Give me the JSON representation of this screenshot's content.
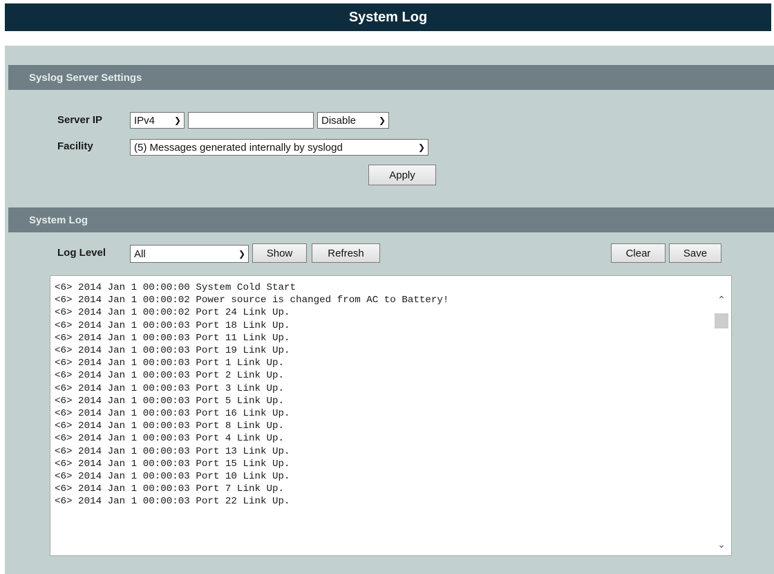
{
  "page_title": "System Log",
  "syslog_settings": {
    "header": "Syslog Server Settings",
    "server_ip_label": "Server IP",
    "ip_version": "IPv4",
    "server_ip_value": "",
    "mode": "Disable",
    "facility_label": "Facility",
    "facility": "(5) Messages generated internally by syslogd",
    "apply_label": "Apply"
  },
  "system_log": {
    "header": "System Log",
    "log_level_label": "Log Level",
    "log_level": "All",
    "show_label": "Show",
    "refresh_label": "Refresh",
    "clear_label": "Clear",
    "save_label": "Save",
    "entries": [
      "<6> 2014 Jan 1 00:00:00 System Cold Start",
      "<6> 2014 Jan 1 00:00:02 Power source is changed from AC to Battery!",
      "<6> 2014 Jan 1 00:00:02 Port 24 Link Up.",
      "<6> 2014 Jan 1 00:00:03 Port 18 Link Up.",
      "<6> 2014 Jan 1 00:00:03 Port 11 Link Up.",
      "<6> 2014 Jan 1 00:00:03 Port 19 Link Up.",
      "<6> 2014 Jan 1 00:00:03 Port 1 Link Up.",
      "<6> 2014 Jan 1 00:00:03 Port 2 Link Up.",
      "<6> 2014 Jan 1 00:00:03 Port 3 Link Up.",
      "<6> 2014 Jan 1 00:00:03 Port 5 Link Up.",
      "<6> 2014 Jan 1 00:00:03 Port 16 Link Up.",
      "<6> 2014 Jan 1 00:00:03 Port 8 Link Up.",
      "<6> 2014 Jan 1 00:00:03 Port 4 Link Up.",
      "<6> 2014 Jan 1 00:00:03 Port 13 Link Up.",
      "<6> 2014 Jan 1 00:00:03 Port 15 Link Up.",
      "<6> 2014 Jan 1 00:00:03 Port 10 Link Up.",
      "<6> 2014 Jan 1 00:00:03 Port 7 Link Up.",
      "<6> 2014 Jan 1 00:00:03 Port 22 Link Up."
    ]
  },
  "icons": {
    "dropdown": "chevron-down-icon",
    "scroll_up": "chevron-up-icon",
    "scroll_down": "chevron-down-icon"
  },
  "colors": {
    "title_bar": "#0d2c3e",
    "panel_bg": "#c3d0d0",
    "section_header": "#6f7f85"
  }
}
